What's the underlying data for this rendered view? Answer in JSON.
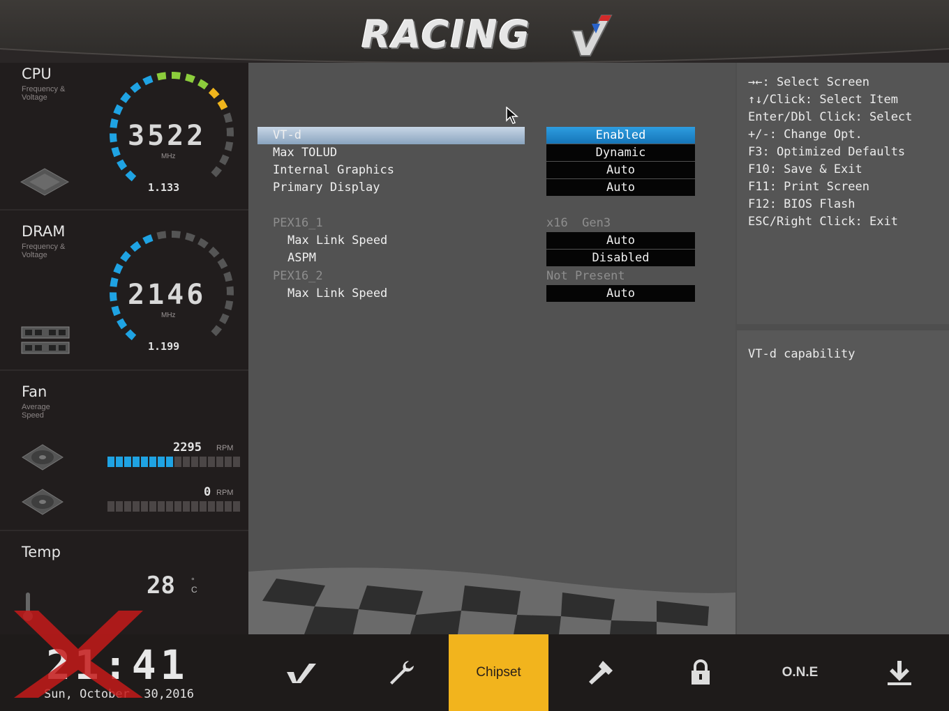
{
  "header": {
    "logo_text": "RACING"
  },
  "cpu": {
    "title": "CPU",
    "subtitle_1": "Frequency &",
    "subtitle_2": "Voltage",
    "frequency": "3522",
    "unit": "MHz",
    "voltage": "1.133"
  },
  "dram": {
    "title": "DRAM",
    "subtitle_1": "Frequency &",
    "subtitle_2": "Voltage",
    "frequency": "2146",
    "unit": "MHz",
    "voltage": "1.199"
  },
  "fan": {
    "title": "Fan",
    "subtitle_1": "Average",
    "subtitle_2": "Speed",
    "unit": "RPM",
    "fans": [
      {
        "rpm": "2295",
        "level": 0.5
      },
      {
        "rpm": "0",
        "level": 0
      }
    ]
  },
  "temp": {
    "title": "Temp",
    "value": "28",
    "unit_deg": "°",
    "unit_c": "C"
  },
  "settings": {
    "rows": [
      {
        "label": "VT-d",
        "value": "Enabled"
      },
      {
        "label": "Max TOLUD",
        "value": "Dynamic"
      },
      {
        "label": "Internal Graphics",
        "value": "Auto"
      },
      {
        "label": "Primary Display",
        "value": "Auto"
      },
      {
        "label": "PEX16_1",
        "value": "x16  Gen3"
      },
      {
        "label": "Max Link Speed",
        "value": "Auto"
      },
      {
        "label": "ASPM",
        "value": "Disabled"
      },
      {
        "label": "PEX16_2",
        "value": "Not Present"
      },
      {
        "label": "Max Link Speed",
        "value": "Auto"
      }
    ]
  },
  "help": {
    "lines": [
      "→←: Select Screen",
      "↑↓/Click: Select Item",
      "Enter/Dbl Click: Select",
      "+/-: Change Opt.",
      "F3: Optimized Defaults",
      "F10: Save & Exit",
      "F11: Print Screen",
      "F12: BIOS Flash",
      "ESC/Right Click: Exit"
    ],
    "description": "VT-d capability"
  },
  "clock": {
    "time": "21:41",
    "date": "Sun, October  30,2016"
  },
  "nav": {
    "chipset_label": "Chipset",
    "one_label": "O.N.E"
  },
  "colors": {
    "accent": "#f2b41d",
    "selection": "#1f8fd6",
    "gauge_blue": "#1fa3e3"
  }
}
